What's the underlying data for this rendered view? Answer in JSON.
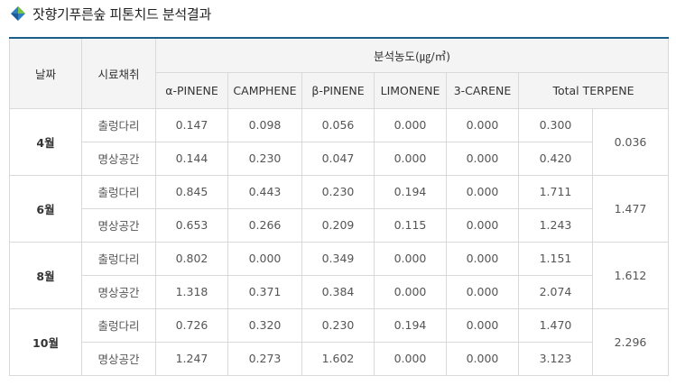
{
  "title": "잣향기푸른숲 피톤치드 분석결과",
  "icon": "diamond-icon",
  "colors": {
    "header_bg": "#f4f4f4",
    "border": "#d9d9d9",
    "accent_top": "#1a5f8a"
  },
  "header": {
    "date": "날짜",
    "site": "시료채취",
    "group": "분석농도(㎍/㎥)",
    "columns": [
      "α-PINENE",
      "CAMPHENE",
      "β-PINENE",
      "LIMONENE",
      "3-CARENE",
      "Total TERPENE"
    ]
  },
  "months": [
    {
      "label": "4월",
      "merged_total": "0.036",
      "rows": [
        {
          "site": "출렁다리",
          "values": [
            "0.147",
            "0.098",
            "0.056",
            "0.000",
            "0.000",
            "0.300"
          ]
        },
        {
          "site": "명상공간",
          "values": [
            "0.144",
            "0.230",
            "0.047",
            "0.000",
            "0.000",
            "0.420"
          ]
        }
      ]
    },
    {
      "label": "6월",
      "merged_total": "1.477",
      "rows": [
        {
          "site": "출렁다리",
          "values": [
            "0.845",
            "0.443",
            "0.230",
            "0.194",
            "0.000",
            "1.711"
          ]
        },
        {
          "site": "명상공간",
          "values": [
            "0.653",
            "0.266",
            "0.209",
            "0.115",
            "0.000",
            "1.243"
          ]
        }
      ]
    },
    {
      "label": "8월",
      "merged_total": "1.612",
      "rows": [
        {
          "site": "출렁다리",
          "values": [
            "0.802",
            "0.000",
            "0.349",
            "0.000",
            "0.000",
            "1.151"
          ]
        },
        {
          "site": "명상공간",
          "values": [
            "1.318",
            "0.371",
            "0.384",
            "0.000",
            "0.000",
            "2.074"
          ]
        }
      ]
    },
    {
      "label": "10월",
      "merged_total": "2.296",
      "rows": [
        {
          "site": "출렁다리",
          "values": [
            "0.726",
            "0.320",
            "0.230",
            "0.194",
            "0.000",
            "1.470"
          ]
        },
        {
          "site": "명상공간",
          "values": [
            "1.247",
            "0.273",
            "1.602",
            "0.000",
            "0.000",
            "3.123"
          ]
        }
      ]
    }
  ]
}
